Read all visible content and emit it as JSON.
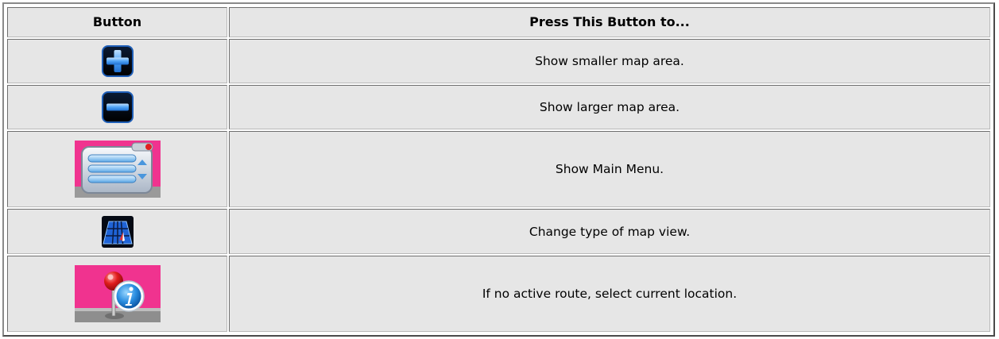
{
  "table": {
    "headers": {
      "button": "Button",
      "action": "Press This Button to..."
    },
    "rows": [
      {
        "icon": "zoom-in-plus-icon",
        "description": "Show smaller map area."
      },
      {
        "icon": "zoom-out-minus-icon",
        "description": "Show larger map area."
      },
      {
        "icon": "main-menu-icon",
        "description": "Show Main Menu."
      },
      {
        "icon": "map-view-grid-icon",
        "description": "Change type of map view."
      },
      {
        "icon": "location-info-pin-icon",
        "description": "If no active route, select current location."
      }
    ]
  },
  "colors": {
    "cell_background": "#e6e6e6",
    "icon_blue": "#3a8ee8",
    "icon_pink": "#f0338f"
  }
}
